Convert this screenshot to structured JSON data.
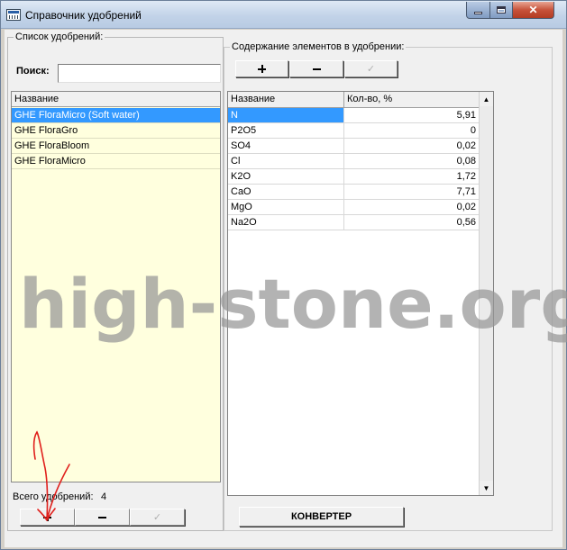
{
  "window": {
    "title": "Справочник удобрений"
  },
  "left": {
    "group_title": "Список удобрений:",
    "search_label": "Поиск:",
    "search_value": "",
    "list_header": "Название",
    "items": [
      "GHE FloraMicro (Soft water)",
      "GHE FloraGro",
      "GHE FloraBloom",
      "GHE FloraMicro"
    ],
    "selected_index": 0,
    "total_label": "Всего удобрений:",
    "total_count": "4"
  },
  "right": {
    "group_title": "Содержание элементов в удобрении:",
    "columns": [
      "Название",
      "Кол-во, %"
    ],
    "rows": [
      {
        "name": "N",
        "value": "5,91"
      },
      {
        "name": "P2O5",
        "value": "0"
      },
      {
        "name": "SO4",
        "value": "0,02"
      },
      {
        "name": "Cl",
        "value": "0,08"
      },
      {
        "name": "K2O",
        "value": "1,72"
      },
      {
        "name": "CaO",
        "value": "7,71"
      },
      {
        "name": "MgO",
        "value": "0,02"
      },
      {
        "name": "Na2O",
        "value": "0,56"
      }
    ],
    "converter_label": "КОНВЕРТЕР"
  },
  "watermark": "high-stone.org",
  "colors": {
    "selection": "#3399ff",
    "list_background": "#ffffde",
    "annotation": "#e0201c"
  }
}
